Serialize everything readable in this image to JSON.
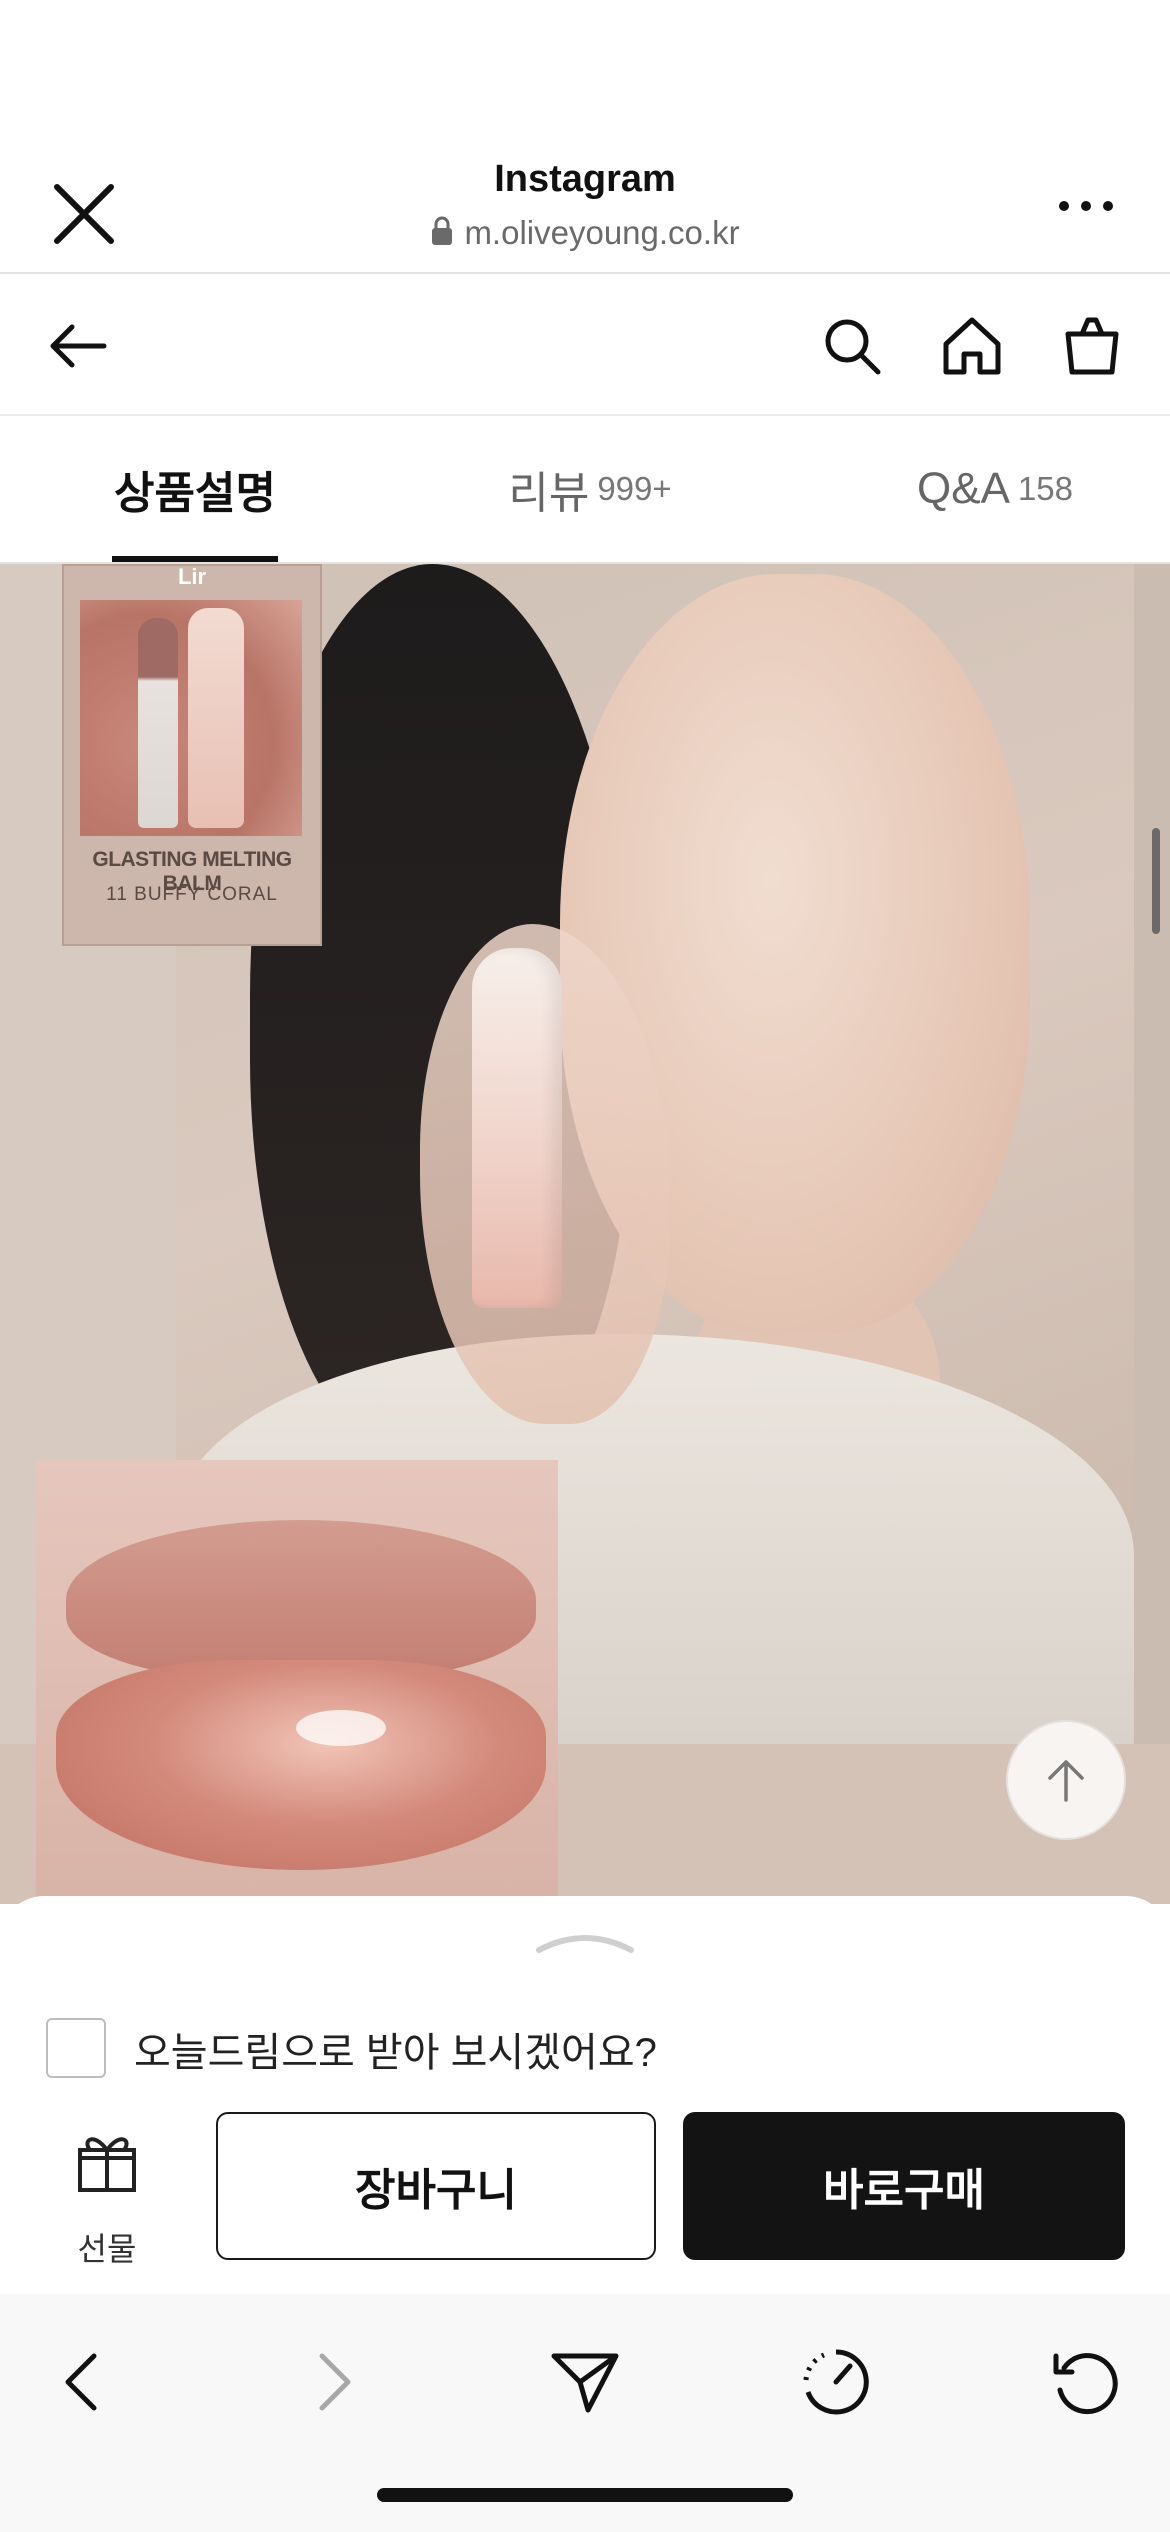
{
  "browser": {
    "title": "Instagram",
    "url": "m.oliveyoung.co.kr"
  },
  "icons": {
    "close": "close-icon",
    "lock": "lock-icon",
    "more": "more-icon",
    "back": "arrow-left-icon",
    "search": "search-icon",
    "home": "home-icon",
    "bag": "shopping-bag-icon",
    "scroll_top": "arrow-up-icon",
    "gift": "gift-icon",
    "nav_back": "chevron-left-icon",
    "nav_forward": "chevron-right-icon",
    "share": "send-icon",
    "speed": "gauge-icon",
    "reload": "reload-icon"
  },
  "tabs": [
    {
      "label": "상품설명",
      "count": "",
      "active": true
    },
    {
      "label": "리뷰",
      "count": "999+",
      "active": false
    },
    {
      "label": "Q&A",
      "count": "158",
      "active": false
    }
  ],
  "product_image": {
    "brand_mark": "Lir",
    "swatch_name": "GLASTING MELTING BALM",
    "swatch_shade": "11 BUFFY CORAL"
  },
  "purchase": {
    "today_dream_label": "오늘드림으로 받아 보시겠어요?",
    "today_dream_checked": false,
    "gift_label": "선물",
    "cart_label": "장바구니",
    "buy_label": "바로구매"
  },
  "colors": {
    "buy_button": "#131313",
    "accent_text": "#111111"
  }
}
